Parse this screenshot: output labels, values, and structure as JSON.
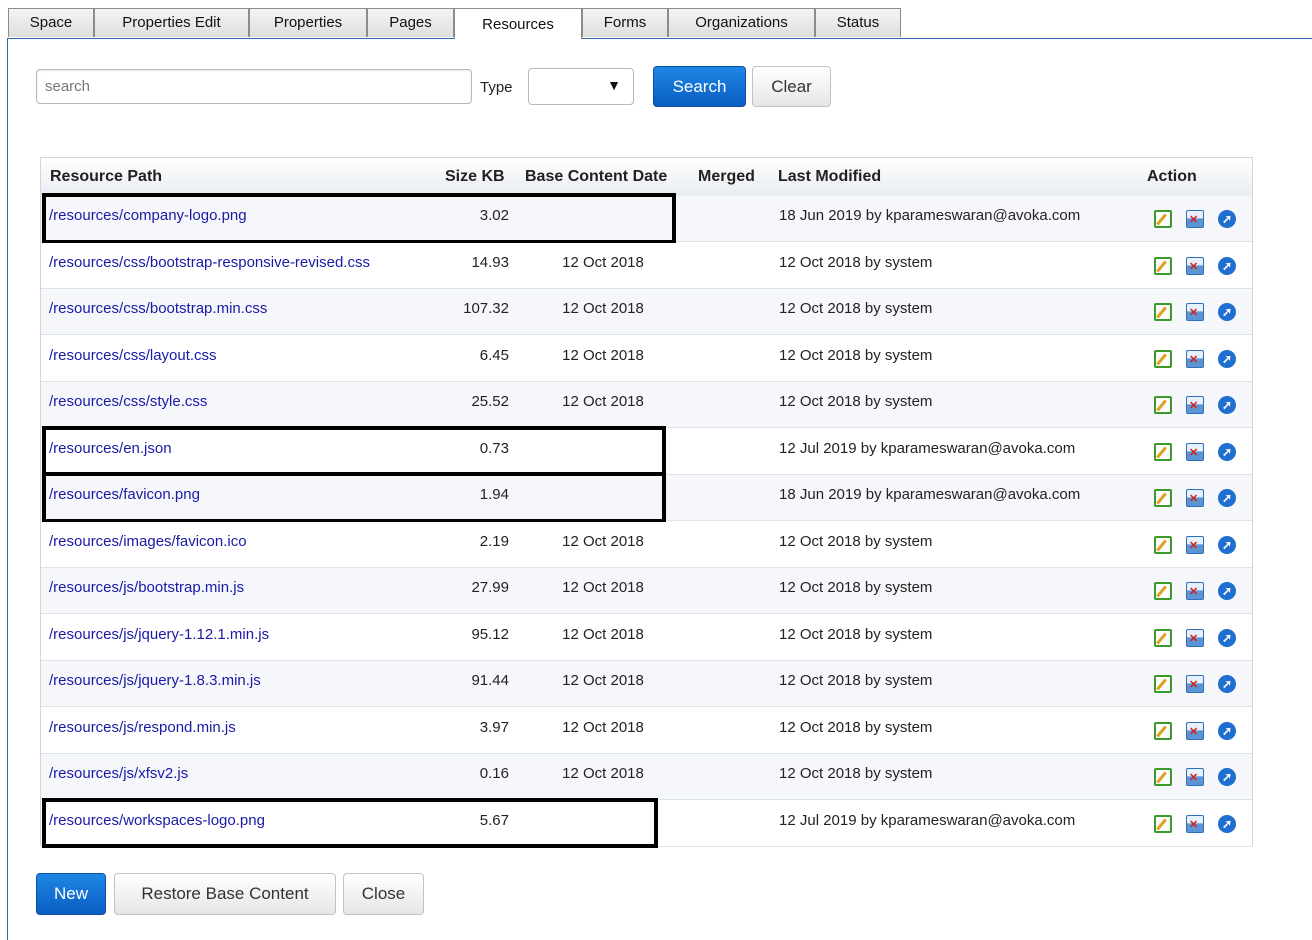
{
  "tabs": [
    "Space",
    "Properties Edit",
    "Properties",
    "Pages",
    "Resources",
    "Forms",
    "Organizations",
    "Status"
  ],
  "active_tab": "Resources",
  "search": {
    "placeholder": "search",
    "value": ""
  },
  "type_filter": {
    "label": "Type",
    "value": "",
    "arrow": "▼"
  },
  "buttons": {
    "search": "Search",
    "clear": "Clear",
    "new": "New",
    "restore": "Restore Base Content",
    "close": "Close"
  },
  "table": {
    "headers": {
      "path": "Resource Path",
      "size": "Size KB",
      "base_date": "Base Content Date",
      "merged": "Merged",
      "modified": "Last Modified",
      "action": "Action"
    },
    "rows": [
      {
        "path": "/resources/company-logo.png",
        "size": "3.02",
        "base_date": "",
        "merged": "",
        "modified": "18 Jun 2019 by kparameswaran@avoka.com",
        "highlighted": true
      },
      {
        "path": "/resources/css/bootstrap-responsive-revised.css",
        "size": "14.93",
        "base_date": "12 Oct 2018",
        "merged": "",
        "modified": "12 Oct 2018 by system",
        "highlighted": false
      },
      {
        "path": "/resources/css/bootstrap.min.css",
        "size": "107.32",
        "base_date": "12 Oct 2018",
        "merged": "",
        "modified": "12 Oct 2018 by system",
        "highlighted": false
      },
      {
        "path": "/resources/css/layout.css",
        "size": "6.45",
        "base_date": "12 Oct 2018",
        "merged": "",
        "modified": "12 Oct 2018 by system",
        "highlighted": false
      },
      {
        "path": "/resources/css/style.css",
        "size": "25.52",
        "base_date": "12 Oct 2018",
        "merged": "",
        "modified": "12 Oct 2018 by system",
        "highlighted": false
      },
      {
        "path": "/resources/en.json",
        "size": "0.73",
        "base_date": "",
        "merged": "",
        "modified": "12 Jul 2019 by kparameswaran@avoka.com",
        "highlighted": true
      },
      {
        "path": "/resources/favicon.png",
        "size": "1.94",
        "base_date": "",
        "merged": "",
        "modified": "18 Jun 2019 by kparameswaran@avoka.com",
        "highlighted": true
      },
      {
        "path": "/resources/images/favicon.ico",
        "size": "2.19",
        "base_date": "12 Oct 2018",
        "merged": "",
        "modified": "12 Oct 2018 by system",
        "highlighted": false
      },
      {
        "path": "/resources/js/bootstrap.min.js",
        "size": "27.99",
        "base_date": "12 Oct 2018",
        "merged": "",
        "modified": "12 Oct 2018 by system",
        "highlighted": false
      },
      {
        "path": "/resources/js/jquery-1.12.1.min.js",
        "size": "95.12",
        "base_date": "12 Oct 2018",
        "merged": "",
        "modified": "12 Oct 2018 by system",
        "highlighted": false
      },
      {
        "path": "/resources/js/jquery-1.8.3.min.js",
        "size": "91.44",
        "base_date": "12 Oct 2018",
        "merged": "",
        "modified": "12 Oct 2018 by system",
        "highlighted": false
      },
      {
        "path": "/resources/js/respond.min.js",
        "size": "3.97",
        "base_date": "12 Oct 2018",
        "merged": "",
        "modified": "12 Oct 2018 by system",
        "highlighted": false
      },
      {
        "path": "/resources/js/xfsv2.js",
        "size": "0.16",
        "base_date": "12 Oct 2018",
        "merged": "",
        "modified": "12 Oct 2018 by system",
        "highlighted": false
      },
      {
        "path": "/resources/workspaces-logo.png",
        "size": "5.67",
        "base_date": "",
        "merged": "",
        "modified": "12 Jul 2019 by kparameswaran@avoka.com",
        "highlighted": true
      }
    ],
    "action_icons": [
      "edit-icon",
      "delete-icon",
      "open-icon"
    ]
  },
  "colors": {
    "link": "#1a1aa6",
    "primary": "#0a5cc2",
    "tab_border": "#2b6cb0",
    "highlight_box": "#000000"
  }
}
